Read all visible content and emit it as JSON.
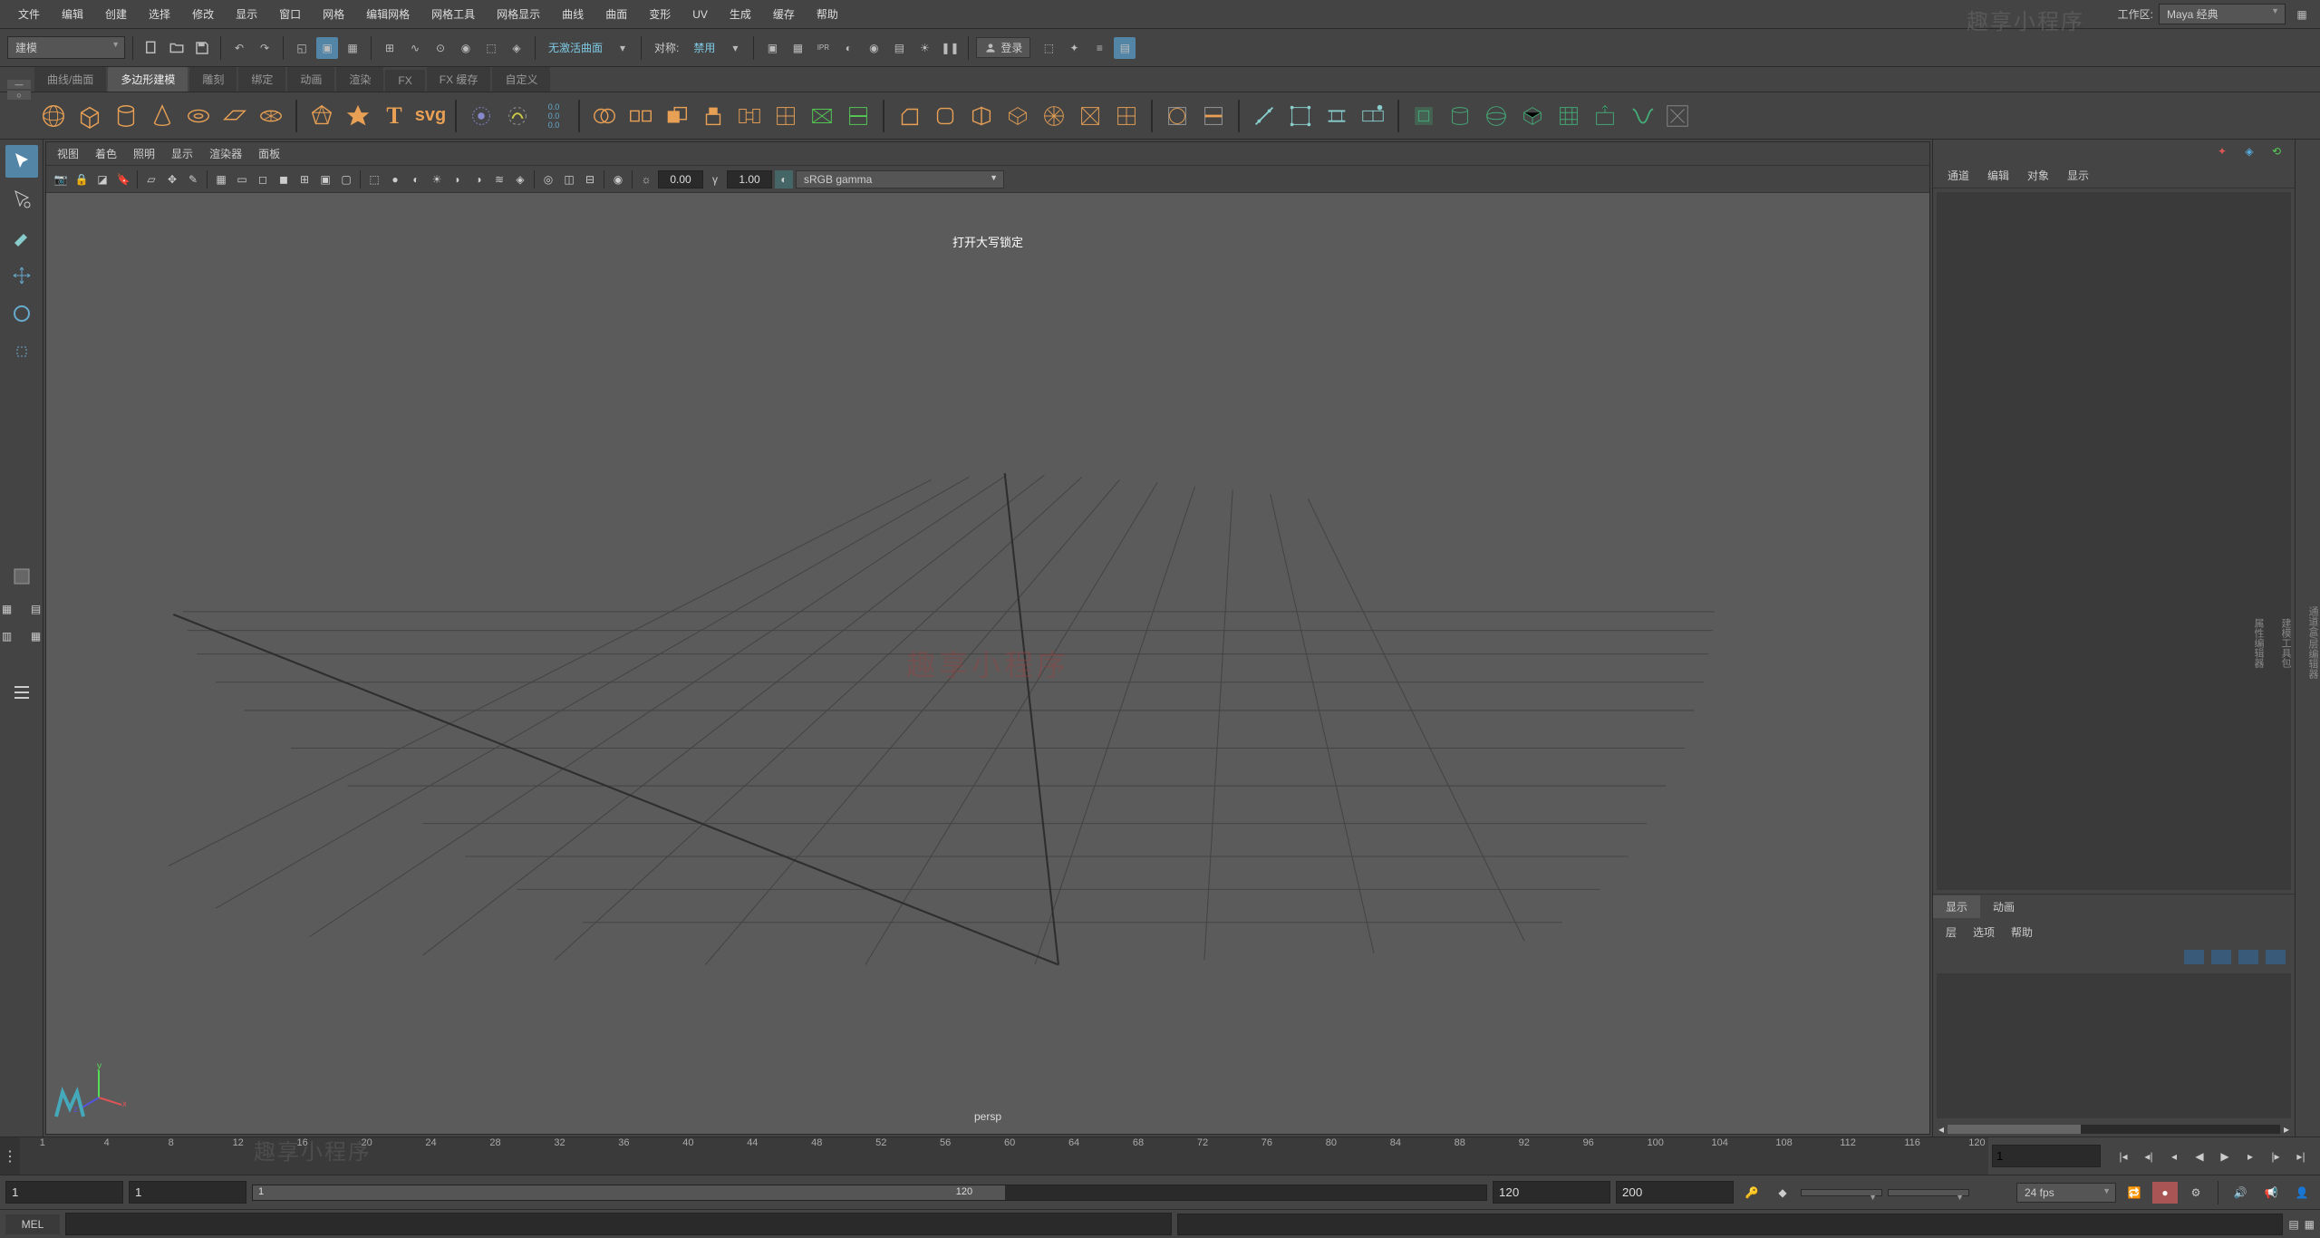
{
  "menu": {
    "items": [
      "文件",
      "编辑",
      "创建",
      "选择",
      "修改",
      "显示",
      "窗口",
      "网格",
      "编辑网格",
      "网格工具",
      "网格显示",
      "曲线",
      "曲面",
      "变形",
      "UV",
      "生成",
      "缓存",
      "帮助"
    ]
  },
  "workspace": {
    "label": "工作区:",
    "value": "Maya 经典"
  },
  "watermark_tr": "趣享小程序",
  "modeSelector": "建模",
  "symmetry": {
    "curveLabel": "无激活曲面",
    "symLabel": "对称:",
    "symValue": "禁用"
  },
  "login": "登录",
  "shelfTabs": [
    "曲线/曲面",
    "多边形建模",
    "雕刻",
    "绑定",
    "动画",
    "渲染",
    "FX",
    "FX 缓存",
    "自定义"
  ],
  "shelfActive": 1,
  "vpMenus": [
    "视图",
    "着色",
    "照明",
    "显示",
    "渲染器",
    "面板"
  ],
  "vpNum1": "0.00",
  "vpNum2": "1.00",
  "vpColorMgmt": "sRGB gamma",
  "capsLock": "打开大写锁定",
  "camera": "persp",
  "watermark_c": "趣享小程序",
  "chanTabs": [
    "通道",
    "编辑",
    "对象",
    "显示"
  ],
  "layerTabs": [
    "显示",
    "动画"
  ],
  "layerMenu": [
    "层",
    "选项",
    "帮助"
  ],
  "timelineTicks": [
    1,
    4,
    8,
    12,
    16,
    20,
    24,
    28,
    32,
    36,
    40,
    44,
    48,
    52,
    56,
    60,
    64,
    68,
    72,
    76,
    80,
    84,
    88,
    92,
    96,
    100,
    104,
    108,
    112,
    116,
    120
  ],
  "timelineCur": "1",
  "range": {
    "start": "1",
    "startB": "1",
    "sliderL": "1",
    "sliderR": "120",
    "endA": "120",
    "endB": "200",
    "fps": "24 fps"
  },
  "cmd": {
    "lang": "MEL"
  },
  "rvert": [
    "通道盒/层编辑器",
    "建模工具包",
    "属性编辑器"
  ],
  "watermark_bl": "趣享小程序"
}
